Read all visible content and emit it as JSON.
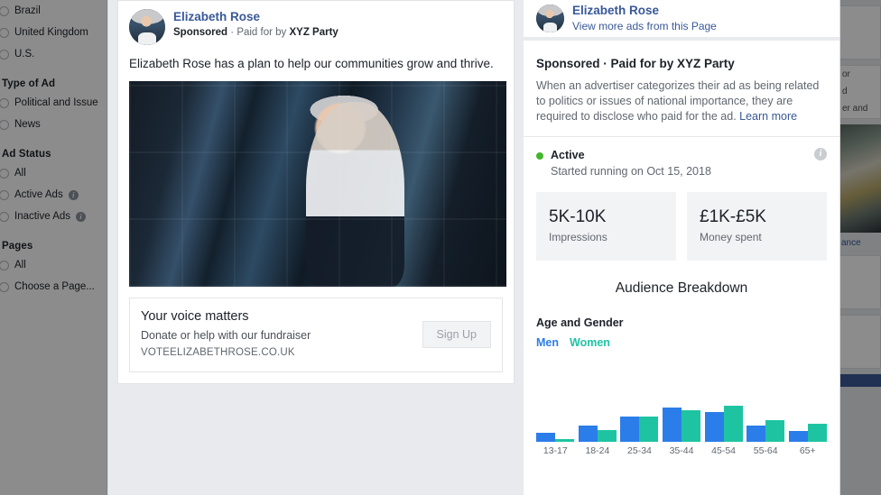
{
  "background": {
    "sidebar": {
      "groups": [
        {
          "title": "",
          "options": [
            {
              "label": "Brazil",
              "info": false
            },
            {
              "label": "United Kingdom",
              "info": false
            },
            {
              "label": "U.S.",
              "info": false
            }
          ]
        },
        {
          "title": "Type of Ad",
          "options": [
            {
              "label": "Political and Issue",
              "info": false
            },
            {
              "label": "News",
              "info": false
            }
          ]
        },
        {
          "title": "Ad Status",
          "options": [
            {
              "label": "All",
              "info": false
            },
            {
              "label": "Active Ads",
              "info": true
            },
            {
              "label": "Inactive Ads",
              "info": true
            }
          ]
        },
        {
          "title": "Pages",
          "options": [
            {
              "label": "All",
              "info": false
            },
            {
              "label": "Choose a Page...",
              "info": false
            }
          ]
        }
      ]
    },
    "right_sliver": {
      "fragment_1": "or",
      "fragment_2": "d",
      "fragment_3": "er and",
      "fragment_4": "ance"
    }
  },
  "modal": {
    "ad_preview": {
      "page_name": "Elizabeth Rose",
      "sponsored_prefix": "Sponsored",
      "separator": "·",
      "paid_for_prefix": "Paid for by",
      "paid_for_advertiser": "XYZ Party",
      "body_text": "Elizabeth Rose has a plan to help our communities grow and thrive.",
      "creative_alt": "Woman with short gray hair in a dark blazer talking on a mobile phone in an office",
      "cta_title": "Your voice matters",
      "cta_subtitle": "Donate or help with our fundraiser",
      "cta_url": "VOTEELIZABETHROSE.CO.UK",
      "cta_button_label": "Sign Up"
    },
    "ad_details": {
      "page_name": "Elizabeth Rose",
      "view_more_label": "View more ads from this Page",
      "disclaimer_title": "Sponsored · Paid for by XYZ Party",
      "disclaimer_text": "When an advertiser categorizes their ad as being related to politics or issues of national importance, they are required to disclose who paid for the ad. ",
      "learn_more_label": "Learn more",
      "status_label": "Active",
      "status_color": "#42b72a",
      "status_started": "Started running on Oct 15, 2018",
      "info_icon_glyph": "i",
      "metrics": [
        {
          "value": "5K-10K",
          "label": "Impressions"
        },
        {
          "value": "£1K-£5K",
          "label": "Money spent"
        }
      ],
      "audience_title": "Audience Breakdown",
      "age_gender_title": "Age and Gender",
      "legend": [
        {
          "label": "Men",
          "color": "#2b7de9"
        },
        {
          "label": "Women",
          "color": "#1ec4a2"
        }
      ]
    }
  },
  "chart_data": {
    "type": "bar",
    "title": "Age and Gender",
    "xlabel": "",
    "ylabel": "",
    "grid": false,
    "legend_position": "top-left",
    "categories": [
      "13-17",
      "18-24",
      "25-34",
      "35-44",
      "45-54",
      "55-64",
      "65+"
    ],
    "series": [
      {
        "name": "Men",
        "color": "#2b7de9",
        "values": [
          10,
          18,
          28,
          38,
          33,
          18,
          12
        ]
      },
      {
        "name": "Women",
        "color": "#1ec4a2",
        "values": [
          3,
          13,
          28,
          35,
          40,
          24,
          20
        ]
      }
    ],
    "ylim": [
      0,
      48
    ]
  }
}
